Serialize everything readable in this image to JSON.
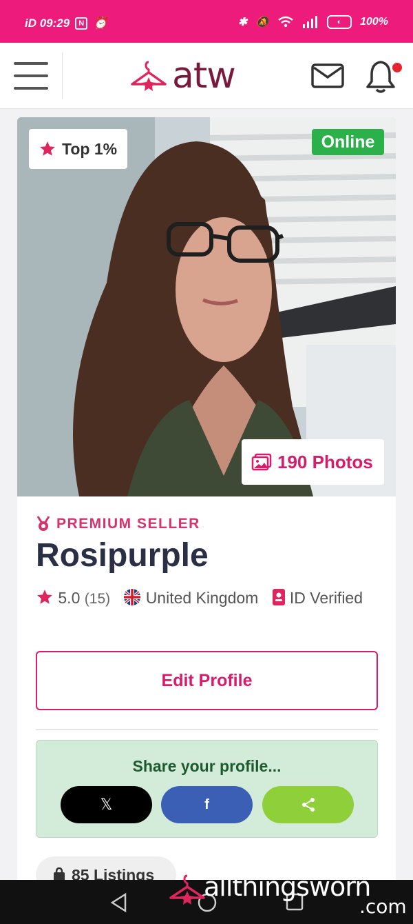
{
  "status": {
    "left_text": "iD 09:29",
    "battery": "100%"
  },
  "header": {
    "logo": "atw"
  },
  "profile": {
    "badge_top": "Top 1%",
    "badge_online": "Online",
    "photos_count": "190 Photos",
    "premium_label": "PREMIUM SELLER",
    "name": "Rosipurple",
    "rating": "5.0",
    "review_count": "(15)",
    "country": "United Kingdom",
    "id_verified": "ID Verified",
    "edit_button": "Edit Profile"
  },
  "share": {
    "title": "Share your profile...",
    "buttons": [
      "x",
      "facebook",
      "share"
    ]
  },
  "listings": "85 Listings",
  "watermark": {
    "text": "allthingsworn",
    "suffix": ".com"
  },
  "colors": {
    "brand": "#ec1b7c",
    "accent": "#d81b6a",
    "online": "#2bb04a",
    "share_bg": "#d3ecd9",
    "facebook": "#3b5fb5",
    "sharebtn": "#8fcf3a"
  }
}
